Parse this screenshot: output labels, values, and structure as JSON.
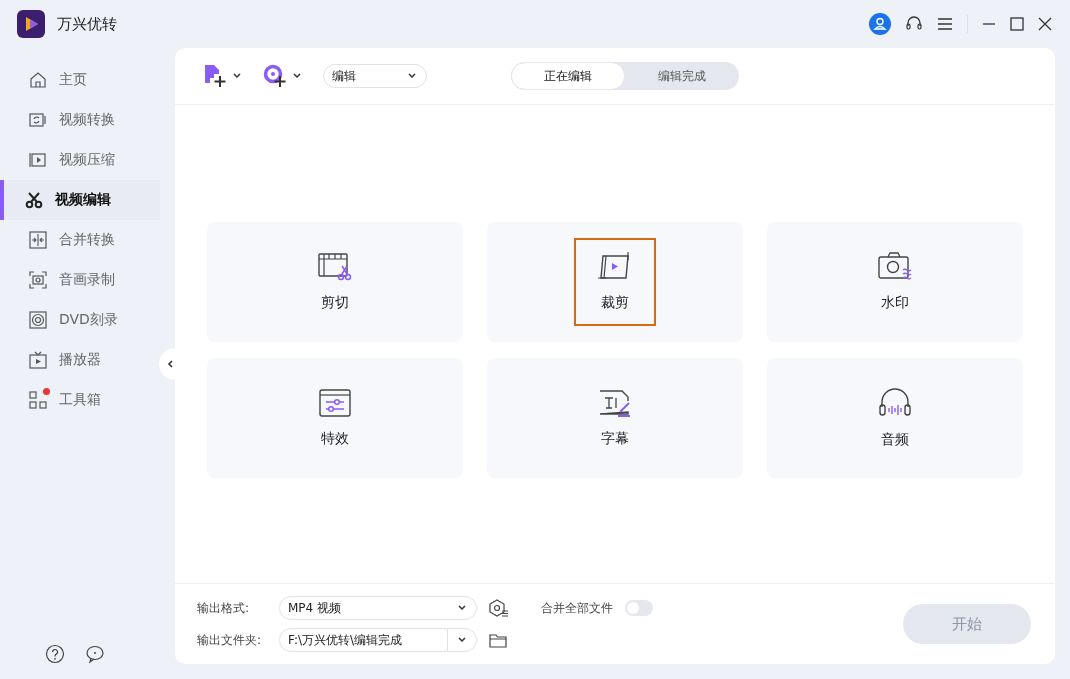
{
  "app": {
    "title": "万兴优转"
  },
  "nav": [
    {
      "label": "主页",
      "kind": "home",
      "selected": false,
      "badge": false
    },
    {
      "label": "视频转换",
      "kind": "convert",
      "selected": false,
      "badge": false
    },
    {
      "label": "视频压缩",
      "kind": "compress",
      "selected": false,
      "badge": false
    },
    {
      "label": "视频编辑",
      "kind": "edit",
      "selected": true,
      "badge": false
    },
    {
      "label": "合并转换",
      "kind": "merge",
      "selected": false,
      "badge": false
    },
    {
      "label": "音画录制",
      "kind": "record",
      "selected": false,
      "badge": false
    },
    {
      "label": "DVD刻录",
      "kind": "dvd",
      "selected": false,
      "badge": false
    },
    {
      "label": "播放器",
      "kind": "player",
      "selected": false,
      "badge": false
    },
    {
      "label": "工具箱",
      "kind": "toolbox",
      "selected": false,
      "badge": true
    }
  ],
  "toolbar": {
    "dropdown": "编辑",
    "tabs": [
      {
        "label": "正在编辑",
        "selected": true
      },
      {
        "label": "编辑完成",
        "selected": false
      }
    ]
  },
  "tools": [
    {
      "label": "剪切",
      "kind": "cut",
      "highlighted": false
    },
    {
      "label": "裁剪",
      "kind": "crop",
      "highlighted": true
    },
    {
      "label": "水印",
      "kind": "watermark",
      "highlighted": false
    },
    {
      "label": "特效",
      "kind": "effect",
      "highlighted": false
    },
    {
      "label": "字幕",
      "kind": "subtitle",
      "highlighted": false
    },
    {
      "label": "音频",
      "kind": "audio",
      "highlighted": false
    }
  ],
  "bottom": {
    "format_label": "输出格式:",
    "format_value": "MP4 视频",
    "merge_label": "合并全部文件",
    "merge_on": false,
    "folder_label": "输出文件夹:",
    "folder_value": "F:\\万兴优转\\编辑完成",
    "start": "开始",
    "start_disabled": true
  }
}
